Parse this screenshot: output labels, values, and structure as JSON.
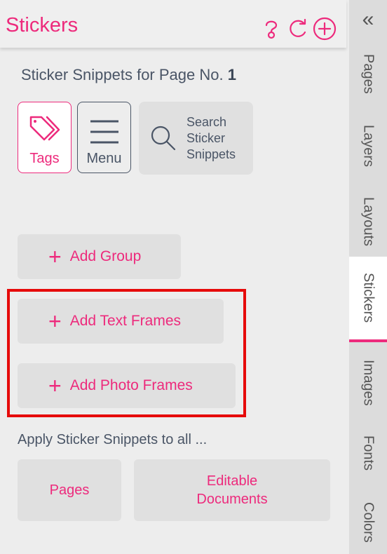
{
  "header": {
    "title": "Stickers",
    "icons": [
      "help-icon",
      "refresh-icon",
      "add-circle-icon"
    ]
  },
  "subtitle": {
    "text": "Sticker Snippets for Page No.",
    "page_number": "1"
  },
  "toolbar": {
    "tags_label": "Tags",
    "menu_label": "Menu",
    "search_label": "Search Sticker Snippets"
  },
  "actions": {
    "add_group": "Add Group",
    "add_text_frames": "Add Text Frames",
    "add_photo_frames": "Add Photo Frames"
  },
  "apply": {
    "label": "Apply Sticker Snippets to all ...",
    "pages": "Pages",
    "editable_documents": "Editable Documents"
  },
  "sidebar": {
    "collapse": "«",
    "tabs": [
      {
        "label": "Pages"
      },
      {
        "label": "Layers"
      },
      {
        "label": "Layouts"
      },
      {
        "label": "Stickers",
        "active": true
      },
      {
        "label": "Images"
      },
      {
        "label": "Fonts"
      },
      {
        "label": "Colors"
      }
    ]
  },
  "colors": {
    "accent": "#ed2a7c",
    "text": "#4a5566",
    "highlight": "#e60b0b"
  }
}
